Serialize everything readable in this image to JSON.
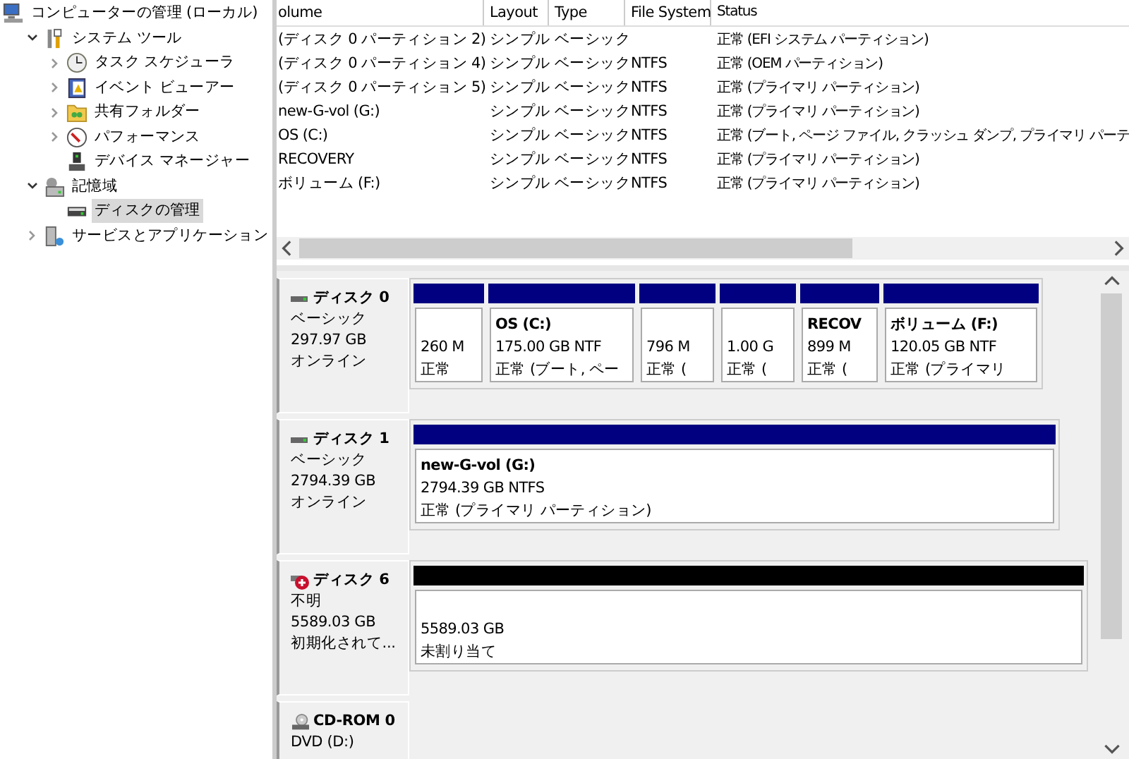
{
  "tree": [
    {
      "label": "コンピューターの管理 (ローカル)",
      "kind": "computer",
      "selected": false,
      "children": [
        {
          "label": "システム ツール",
          "kind": "tools",
          "expanded": true,
          "selected": false,
          "children": [
            {
              "label": "タスク スケジューラ",
              "kind": "clock",
              "expanded": false,
              "selected": false
            },
            {
              "label": "イベント ビューアー",
              "kind": "log",
              "expanded": false,
              "selected": false
            },
            {
              "label": "共有フォルダー",
              "kind": "folder",
              "expanded": false,
              "selected": false
            },
            {
              "label": "パフォーマンス",
              "kind": "gauge",
              "expanded": false,
              "selected": false
            },
            {
              "label": "デバイス マネージャー",
              "kind": "device",
              "selected": false
            }
          ]
        },
        {
          "label": "記憶域",
          "kind": "storage",
          "expanded": true,
          "selected": false,
          "children": [
            {
              "label": "ディスクの管理",
              "kind": "disk",
              "selected": true
            }
          ]
        },
        {
          "label": "サービスとアプリケーション",
          "kind": "services",
          "expanded": false,
          "selected": false
        }
      ]
    }
  ],
  "table": {
    "columns": [
      "olume",
      "Layout",
      "Type",
      "File System",
      "Status"
    ],
    "rows": [
      [
        "(ディスク 0 パーティション 2)",
        "シンプル",
        "ベーシック",
        null,
        "正常 (EFI システム パーティション)"
      ],
      [
        "(ディスク 0 パーティション 4)",
        "シンプル",
        "ベーシック",
        "NTFS",
        "正常 (OEM パーティション)"
      ],
      [
        "(ディスク 0 パーティション 5)",
        "シンプル",
        "ベーシック",
        "NTFS",
        "正常 (プライマリ パーティション)"
      ],
      [
        "new-G-vol (G:)",
        "シンプル",
        "ベーシック",
        "NTFS",
        "正常 (プライマリ パーティション)"
      ],
      [
        "OS (C:)",
        "シンプル",
        "ベーシック",
        "NTFS",
        "正常 (ブート, ページ ファイル, クラッシュ ダンプ, プライマリ パーテ"
      ],
      [
        "RECOVERY",
        "シンプル",
        "ベーシック",
        "NTFS",
        "正常 (プライマリ パーティション)"
      ],
      [
        "ボリューム (F:)",
        "シンプル",
        "ベーシック",
        "NTFS",
        "正常 (プライマリ パーティション)"
      ]
    ]
  },
  "disks": [
    {
      "name": "ディスク 0",
      "kind": "disk",
      "lines": [
        "ベーシック",
        "297.97 GB",
        "オンライン"
      ],
      "partitions": [
        {
          "size": "260 M",
          "status": "正常",
          "color": "#000080"
        },
        {
          "name": "OS  (C:)",
          "size": "175.00 GB NTF",
          "status": "正常 (ブート, ペー",
          "color": "#000080"
        },
        {
          "size": "796 M",
          "status": "正常 (",
          "color": "#000080"
        },
        {
          "size": "1.00 G",
          "status": "正常 (",
          "color": "#000080"
        },
        {
          "name": "RECOV",
          "size": "899 M",
          "status": "正常 (",
          "color": "#000080"
        },
        {
          "name": "ボリューム  (F:)",
          "size": "120.05 GB NTF",
          "status": "正常 (プライマリ",
          "color": "#000080"
        }
      ]
    },
    {
      "name": "ディスク 1",
      "kind": "disk",
      "lines": [
        "ベーシック",
        "2794.39 GB",
        "オンライン"
      ],
      "partitions": [
        {
          "name": "new-G-vol  (G:)",
          "size": "2794.39 GB NTFS",
          "status": "正常 (プライマリ パーティション)",
          "color": "#000080"
        }
      ]
    },
    {
      "name": "ディスク 6",
      "kind": "disk-error",
      "lines": [
        "不明",
        "5589.03 GB",
        "初期化されて..."
      ],
      "partitions": [
        {
          "size": "5589.03 GB",
          "status": "未割り当て",
          "color": "#000000"
        }
      ]
    },
    {
      "name": "CD-ROM 0",
      "kind": "cdrom",
      "lines": [
        "DVD (D:)"
      ]
    }
  ]
}
